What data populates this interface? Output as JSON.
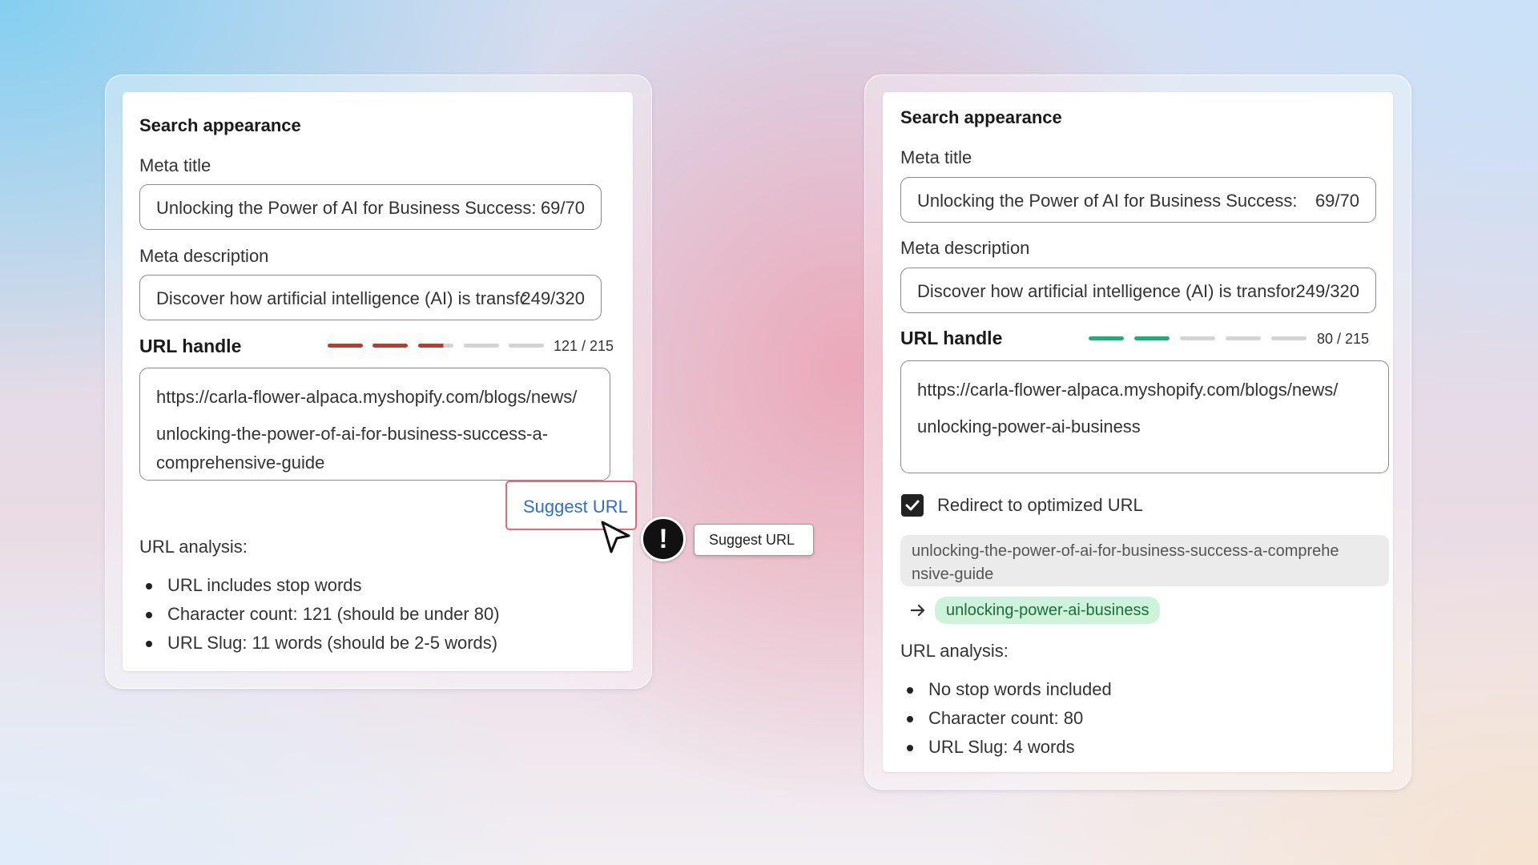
{
  "left_panel": {
    "section_title": "Search appearance",
    "meta_title_label": "Meta title",
    "meta_title_value": "Unlocking the Power of AI for Business Success: A Comprehensive Guide",
    "meta_title_count": "69/70",
    "meta_description_label": "Meta description",
    "meta_description_value": "Discover how artificial intelligence (AI) is transforming",
    "meta_description_count": "249/320",
    "url_handle_label": "URL handle",
    "url_score_count": "121 / 215",
    "url_score_segments_filled": 2.7,
    "url_score_segments_total": 5,
    "url_score_color": "#c0392b",
    "url_line1": "https://carla-flower-alpaca.myshopify.com/blogs/news/",
    "url_line2": "unlocking-the-power-of-ai-for-business-success-a-",
    "url_line3": "comprehensive-guide",
    "suggest_button_label": "Suggest URL",
    "analysis_title": "URL analysis:",
    "analysis_items": [
      "URL includes stop words",
      "Character count: 121 (should be under 80)",
      "URL Slug: 11 words (should be 2-5 words)"
    ]
  },
  "tooltip": {
    "label": "Suggest URL",
    "alert_icon": "exclamation-icon",
    "cursor_icon": "pointer-cursor-icon"
  },
  "right_panel": {
    "section_title": "Search appearance",
    "meta_title_label": "Meta title",
    "meta_title_value": "Unlocking the Power of AI for Business Success: A Comprehensive Guide",
    "meta_title_count": "69/70",
    "meta_description_label": "Meta description",
    "meta_description_value": "Discover how artificial intelligence (AI) is transforming",
    "meta_description_count": "249/320",
    "url_handle_label": "URL handle",
    "url_score_count": "80 / 215",
    "url_score_segments_filled": 2,
    "url_score_segments_total": 5,
    "url_score_color": "#2aa877",
    "url_line1": "https://carla-flower-alpaca.myshopify.com/blogs/news/",
    "url_line2": "unlocking-power-ai-business",
    "redirect_checkbox_checked": true,
    "redirect_label": "Redirect to optimized URL",
    "old_slug": "unlocking-the-power-of-ai-for-business-success-a-comprehe nsive-guide",
    "arrow_icon": "arrow-right-icon",
    "new_slug": "unlocking-power-ai-business",
    "analysis_title": "URL analysis:",
    "analysis_items": [
      "No stop words included",
      "Character count: 80",
      "URL Slug: 4 words"
    ]
  }
}
